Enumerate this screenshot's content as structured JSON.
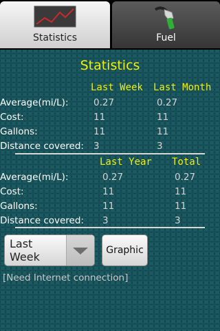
{
  "tabs": [
    {
      "label": "Statistics",
      "icon": "line-chart-icon",
      "active": true
    },
    {
      "label": "Fuel",
      "icon": "fuel-pump-nozzle-icon",
      "active": false
    }
  ],
  "title": "Statistics",
  "table1": {
    "headers": [
      "Last Week",
      "Last Month"
    ],
    "rows": [
      {
        "label": "Average(mi/L):",
        "values": [
          "0.27",
          "0.27"
        ]
      },
      {
        "label": "Cost:",
        "values": [
          "11",
          "11"
        ]
      },
      {
        "label": "Gallons:",
        "values": [
          "11",
          "11"
        ]
      },
      {
        "label": "Distance covered:",
        "values": [
          "3",
          "3"
        ]
      }
    ]
  },
  "table2": {
    "headers": [
      "Last Year",
      "Total"
    ],
    "rows": [
      {
        "label": "Average(mi/L):",
        "values": [
          "0.27",
          "0.27"
        ]
      },
      {
        "label": "Cost:",
        "values": [
          "11",
          "11"
        ]
      },
      {
        "label": "Gallons:",
        "values": [
          "11",
          "11"
        ]
      },
      {
        "label": "Distance covered:",
        "values": [
          "3",
          "3"
        ]
      }
    ]
  },
  "period_select": {
    "selected": "Last Week"
  },
  "graphic_button": {
    "label": "Graphic"
  },
  "status": "[Need Internet connection]",
  "colors": {
    "accent_yellow": "#f3f000",
    "background": "#103a40"
  }
}
